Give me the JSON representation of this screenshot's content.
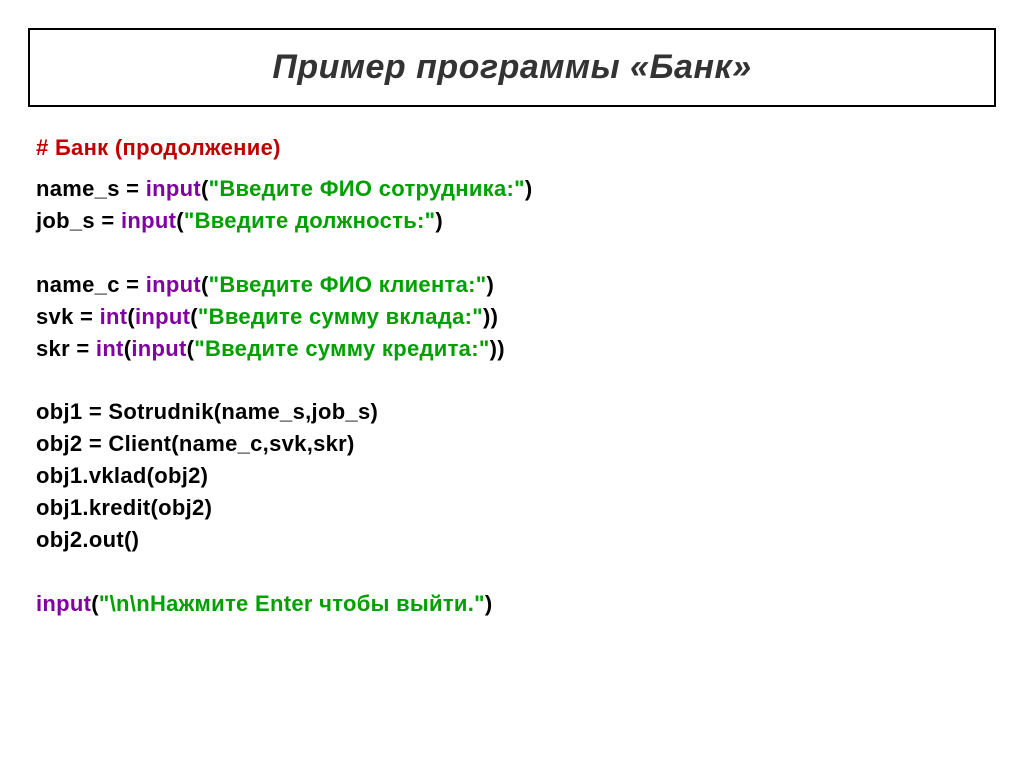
{
  "title": "Пример программы «Банк»",
  "subtitle": "# Банк (продолжение)",
  "code": {
    "l1_a": "name_s = ",
    "l1_fn": "input",
    "l1_b": "(",
    "l1_s": "\"Введите ФИО сотрудника:\"",
    "l1_c": ")",
    "l2_a": "job_s  = ",
    "l2_fn": "input",
    "l2_b": "(",
    "l2_s": "\"Введите должность:\"",
    "l2_c": ")",
    "l3_a": "name_c = ",
    "l3_fn": "input",
    "l3_b": "(",
    "l3_s": "\"Введите ФИО клиента:\"",
    "l3_c": ")",
    "l4_a": "svk = ",
    "l4_fn1": "int",
    "l4_b": "(",
    "l4_fn2": "input",
    "l4_c": "(",
    "l4_s": "\"Введите сумму вклада:\"",
    "l4_d": "))",
    "l5_a": "skr = ",
    "l5_fn1": "int",
    "l5_b": "(",
    "l5_fn2": "input",
    "l5_c": "(",
    "l5_s": "\"Введите сумму кредита:\"",
    "l5_d": "))",
    "l6": "obj1 = Sotrudnik(name_s,job_s)",
    "l7": "obj2 = Client(name_c,svk,skr)",
    "l8": "obj1.vklad(obj2)",
    "l9": "obj1.kredit(obj2)",
    "l10": "obj2.out()",
    "l11_fn": "input",
    "l11_b": "(",
    "l11_s": "\"\\n\\nНажмите Enter чтобы выйти.\"",
    "l11_c": ")"
  }
}
